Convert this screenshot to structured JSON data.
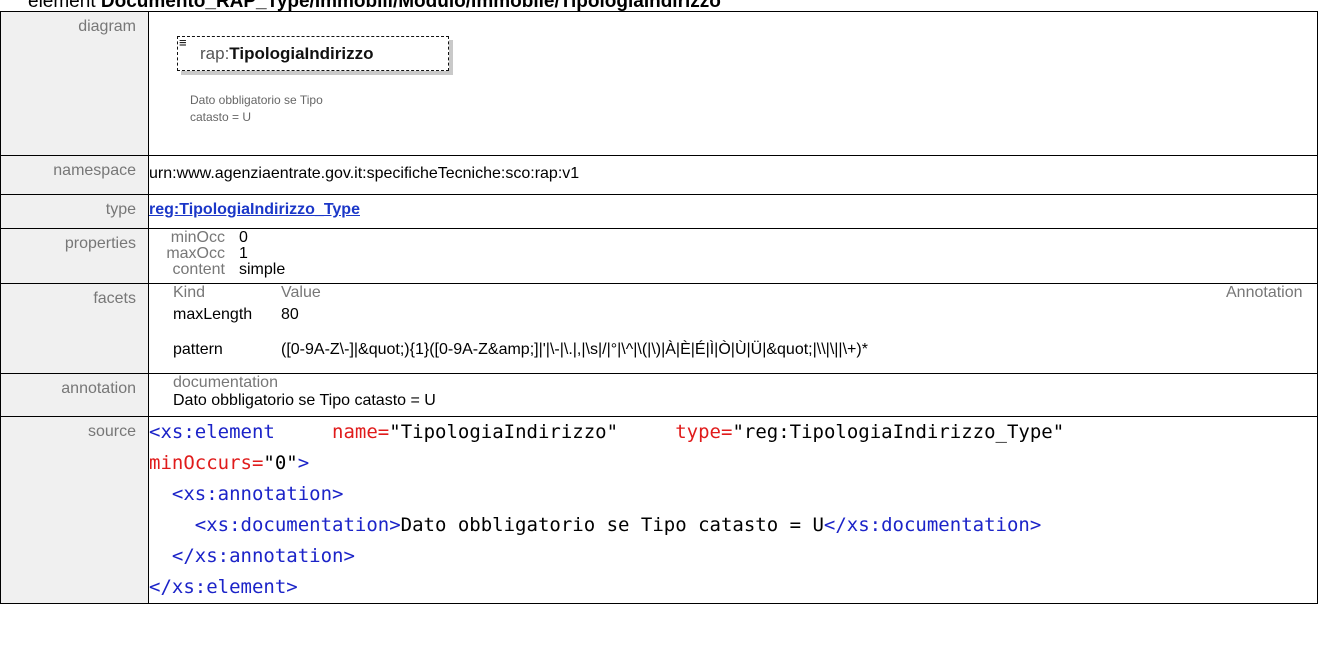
{
  "header": {
    "prefix": "element ",
    "path": "Documento_RAP_Type/Immobili/Modulo/Immobile/TipologiaIndirizzo"
  },
  "rows": {
    "diagram": "diagram",
    "namespace": "namespace",
    "type": "type",
    "properties": "properties",
    "facets": "facets",
    "annotation": "annotation",
    "source": "source"
  },
  "diagram": {
    "icon": "≡",
    "prefix": "rap:",
    "name": "TipologiaIndirizzo",
    "note": "Dato obbligatorio se Tipo catasto = U"
  },
  "namespace_value": "urn:www.agenziaentrate.gov.it:specificheTecniche:sco:rap:v1",
  "type_value": "reg:TipologiaIndirizzo_Type",
  "properties": [
    {
      "key": "minOcc",
      "value": "0"
    },
    {
      "key": "maxOcc",
      "value": "1"
    },
    {
      "key": "content",
      "value": "simple"
    }
  ],
  "facets": {
    "headers": {
      "kind": "Kind",
      "value": "Value",
      "annotation": "Annotation"
    },
    "rows": [
      {
        "kind": "maxLength",
        "value": "80"
      },
      {
        "kind": "pattern",
        "value": "([0-9A-Z\\-]|&quot;){1}([0-9A-Z&amp;]|'|\\-|\\.|,|\\s|/|°|\\^|\\(|\\)|À|È|É|Ì|Ò|Ù|Ü|&quot;|\\\\|\\||\\+)*"
      }
    ]
  },
  "annotation": {
    "head": "documentation",
    "text": "Dato obbligatorio se Tipo catasto = U"
  },
  "source": {
    "l1_open": "<xs:element",
    "l1_attr1": "name=",
    "l1_val1": "\"TipologiaIndirizzo\"",
    "l1_attr2": "type=",
    "l1_val2": "\"reg:TipologiaIndirizzo_Type\"",
    "l2_attr": "minOccurs=",
    "l2_val": "\"0\"",
    "l2_close": ">",
    "l3": "<xs:annotation>",
    "l4_open": "<xs:documentation>",
    "l4_text": "Dato obbligatorio se Tipo catasto = U",
    "l4_close": "</xs:documentation>",
    "l5": "</xs:annotation>",
    "l6": "</xs:element>"
  }
}
